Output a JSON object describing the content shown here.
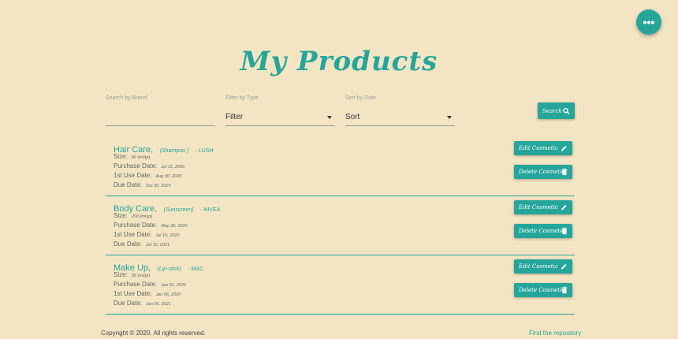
{
  "fab": {
    "icon": "more-horiz-icon",
    "label": "•••"
  },
  "page_title": "My Products",
  "filters": {
    "brand": {
      "label": "Search by Brand",
      "value": ""
    },
    "type": {
      "label": "Filter by Type",
      "value": "Filter"
    },
    "sort": {
      "label": "Sort by Date",
      "value": "Sort"
    }
  },
  "search_button": {
    "label": "Search"
  },
  "products": [
    {
      "name": "Hair Care,",
      "type": "(Shampoo )",
      "brand": "- LUSH",
      "size_label": "Size:",
      "size": "90 (ml/gr)",
      "purchase_label": "Purchase Date:",
      "purchase": "Jul 15, 2020",
      "first_use_label": "1st Use Date:",
      "first_use": "Aug 30, 2020",
      "due_label": "Due Date:",
      "due": "Oct 30, 2020",
      "edit_label": "Edit Cosmetic",
      "delete_label": "Delete Cosmetic"
    },
    {
      "name": "Body Care,",
      "type": "(Sunscreen)",
      "brand": "- NIVEA",
      "size_label": "Size:",
      "size": "200 (ml/gr)",
      "purchase_label": "Purchase Date:",
      "purchase": "May 30, 2020",
      "first_use_label": "1st Use Date:",
      "first_use": "Jul 10, 2020",
      "due_label": "Due Date:",
      "due": "Jul 10, 2021",
      "edit_label": "Edit Cosmetic",
      "delete_label": "Delete Cosmetic"
    },
    {
      "name": "Make Up,",
      "type": "(Lip-stick)",
      "brand": "- MAC",
      "size_label": "Size:",
      "size": "35 (ml/gr)",
      "purchase_label": "Purchase Date:",
      "purchase": "Jan 01, 2020",
      "first_use_label": "1st Use Date:",
      "first_use": "Jan 06, 2020",
      "due_label": "Due Date:",
      "due": "Jan 06, 2021",
      "edit_label": "Edit Cosmetic",
      "delete_label": "Delete Cosmetic"
    }
  ],
  "footer": {
    "copyright": "Copyright © 2020. All rights reserved.",
    "repo_link": "Find the repository"
  },
  "colors": {
    "accent": "#26a69a",
    "background": "#f3e5c3"
  }
}
